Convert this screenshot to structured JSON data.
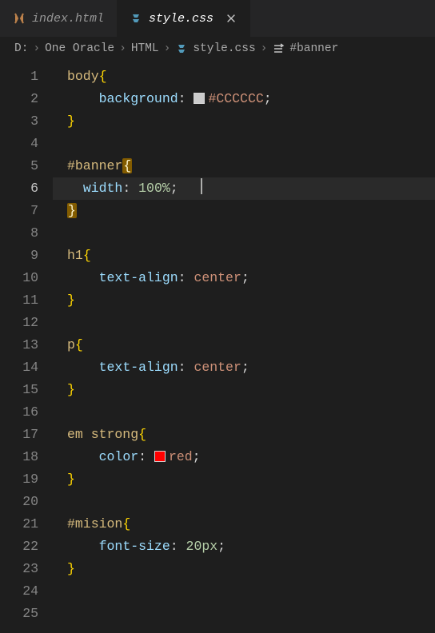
{
  "tabs": [
    {
      "label": "index.html",
      "type": "html"
    },
    {
      "label": "style.css",
      "type": "css",
      "active": true
    }
  ],
  "breadcrumbs": {
    "p0": "D:",
    "p1": "One Oracle",
    "p2": "HTML",
    "p3": "style.css",
    "p4": "#banner"
  },
  "lines": {
    "count": 25,
    "current": 6
  },
  "code": {
    "l1": {
      "sel": "body",
      "op": "{"
    },
    "l2": {
      "prop": "background",
      "val": "#CCCCCC",
      "swatch": "#CCCCCC"
    },
    "l3": {
      "close": "}"
    },
    "l5": {
      "sel": "#banner",
      "op": "{"
    },
    "l6": {
      "prop": "width",
      "num": "100%",
      "cursor": true
    },
    "l7": {
      "close": "}"
    },
    "l9": {
      "sel": "h1",
      "op": "{"
    },
    "l10": {
      "prop": "text-align",
      "valkw": "center"
    },
    "l11": {
      "close": "}"
    },
    "l13": {
      "sel": "p",
      "op": "{"
    },
    "l14": {
      "prop": "text-align",
      "valkw": "center"
    },
    "l15": {
      "close": "}"
    },
    "l17": {
      "sel": "em strong",
      "op": "{"
    },
    "l18": {
      "prop": "color",
      "val": "red",
      "swatch": "#ff0000"
    },
    "l19": {
      "close": "}"
    },
    "l21": {
      "sel": "#mision",
      "op": "{"
    },
    "l22": {
      "prop": "font-size",
      "num": "20px"
    },
    "l23": {
      "close": "}"
    }
  }
}
